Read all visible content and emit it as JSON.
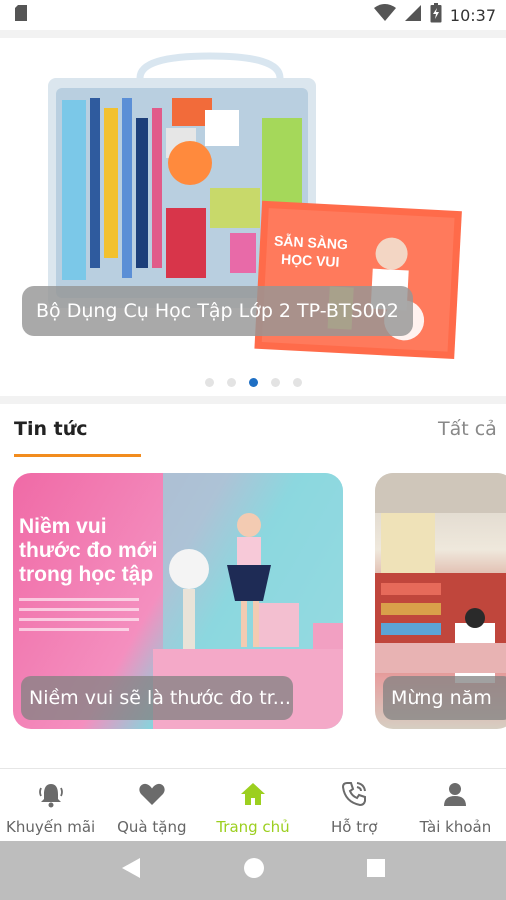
{
  "status_bar": {
    "time": "10:37",
    "icons": [
      "sim-card-icon",
      "wifi-icon",
      "signal-icon",
      "battery-icon"
    ]
  },
  "banner": {
    "caption": "Bộ Dụng Cụ Học Tập Lớp 2 TP-BTS002",
    "slides_total": 5,
    "active_slide": 3,
    "poster_text": [
      "SẴN SÀNG",
      "HỌC VUI"
    ]
  },
  "news": {
    "title": "Tin tức",
    "see_all": "Tất cả",
    "cards": [
      {
        "caption": "Niềm vui sẽ là thước đo tr...",
        "poster_headline": [
          "Niềm vui",
          "thước đo mới",
          "trong học tập"
        ]
      },
      {
        "caption": "Mừng năm"
      }
    ]
  },
  "bottom_nav": {
    "items": [
      {
        "label": "Khuyến mãi",
        "icon": "bell-icon",
        "active": false
      },
      {
        "label": "Quà tặng",
        "icon": "heart-icon",
        "active": false
      },
      {
        "label": "Trang chủ",
        "icon": "home-icon",
        "active": true
      },
      {
        "label": "Hỗ trợ",
        "icon": "phone-icon",
        "active": false
      },
      {
        "label": "Tài khoản",
        "icon": "user-icon",
        "active": false
      }
    ]
  },
  "colors": {
    "accent_orange": "#f28c1e",
    "active_green": "#9ccf1f",
    "dot_active": "#1e6fc4",
    "nav_inactive": "#666666"
  }
}
